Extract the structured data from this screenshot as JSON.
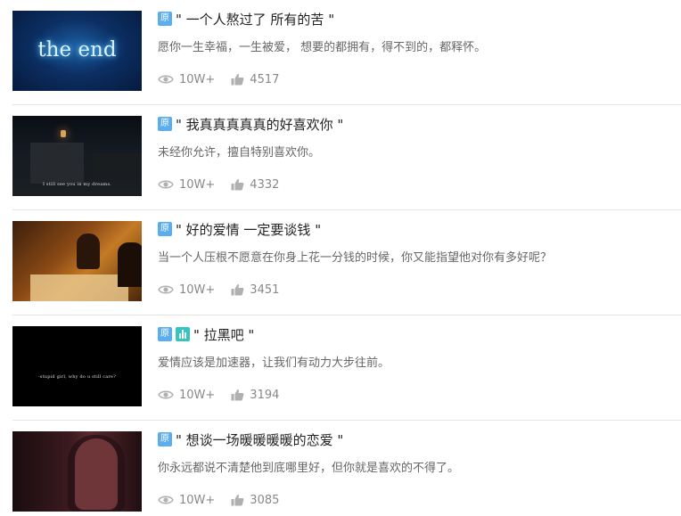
{
  "badges": {
    "original": "原"
  },
  "icons": {
    "views": "eye-icon",
    "likes": "thumbs-up-icon",
    "audio": "audio-bars-icon"
  },
  "colors": {
    "badge_original": "#5aaef0",
    "badge_audio": "#34c5c0"
  },
  "items": [
    {
      "thumbnail_text": "the end",
      "title": "\" 一个人熬过了 所有的苦 \"",
      "desc": "愿你一生幸福，一生被爱， 想要的都拥有，得不到的，都释怀。",
      "views": "10W+",
      "likes": "4517",
      "has_audio": false
    },
    {
      "thumbnail_text": "I still see you in my dreams.",
      "title": "\" 我真真真真真的好喜欢你 \"",
      "desc": "未经你允许，擅自特别喜欢你。",
      "views": "10W+",
      "likes": "4332",
      "has_audio": false
    },
    {
      "thumbnail_text": "",
      "title": "\" 好的爱情 一定要谈钱 \"",
      "desc": "当一个人压根不愿意在你身上花一分钱的时候，你又能指望他对你有多好呢？",
      "views": "10W+",
      "likes": "3451",
      "has_audio": false
    },
    {
      "thumbnail_text": "-stupid girl, why do u still care?",
      "title": "\" 拉黑吧 \"",
      "desc": "爱情应该是加速器，让我们有动力大步往前。",
      "views": "10W+",
      "likes": "3194",
      "has_audio": true
    },
    {
      "thumbnail_text": "",
      "title": "\" 想谈一场暖暖暖暖的恋爱 \"",
      "desc": "你永远都说不清楚他到底哪里好，但你就是喜欢的不得了。",
      "views": "10W+",
      "likes": "3085",
      "has_audio": false
    }
  ]
}
